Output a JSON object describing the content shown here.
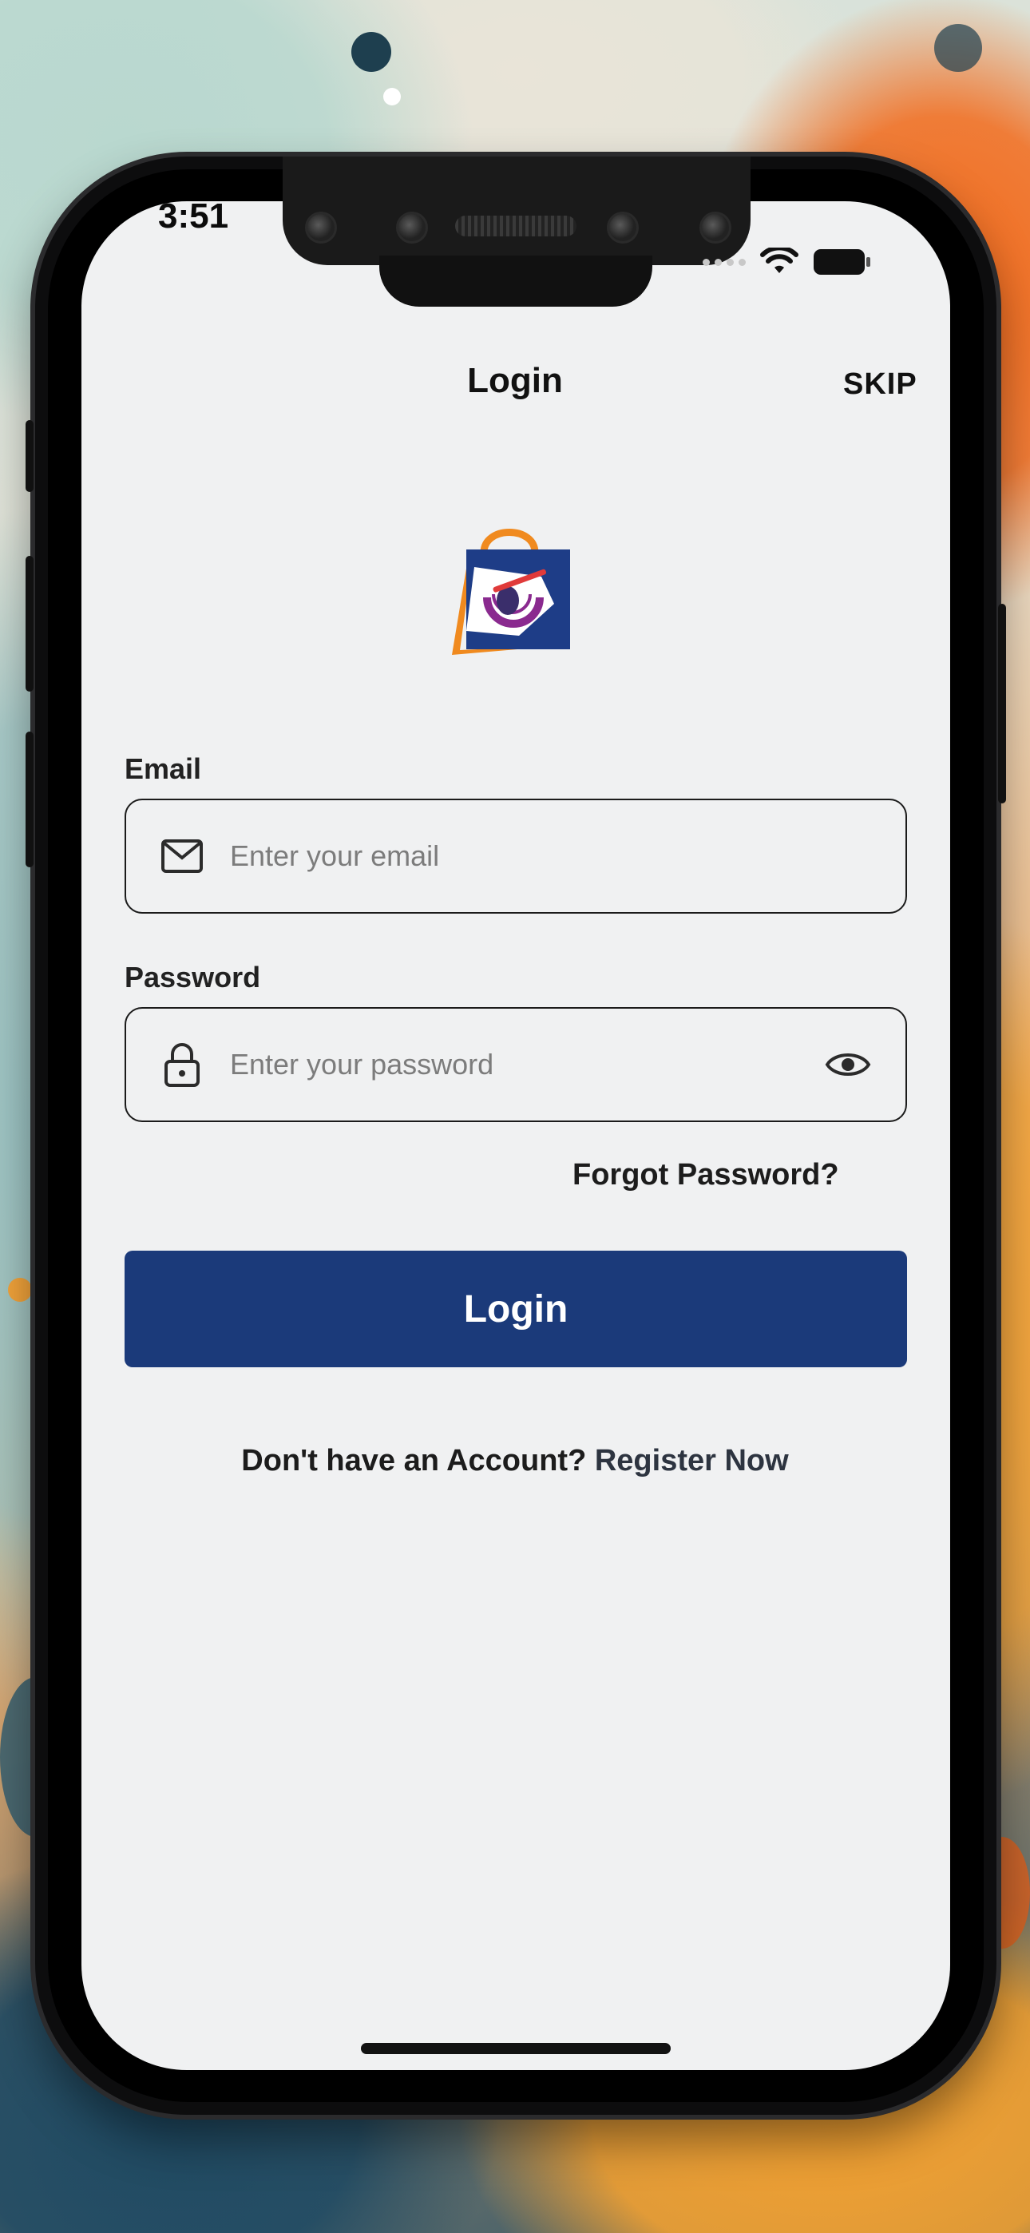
{
  "status_bar": {
    "time": "3:51"
  },
  "header": {
    "title": "Login",
    "skip_label": "SKIP"
  },
  "logo": {
    "name": "shopping-bag-logo"
  },
  "email": {
    "label": "Email",
    "placeholder": "Enter your email",
    "value": "",
    "icon": "mail-icon"
  },
  "password": {
    "label": "Password",
    "placeholder": "Enter your password",
    "value": "",
    "icon": "lock-icon",
    "toggle_icon": "eye-icon"
  },
  "forgot_label": "Forgot Password?",
  "login_button": "Login",
  "register": {
    "question": "Don't have an Account?",
    "link": "Register Now"
  },
  "colors": {
    "primary": "#1b3a7a",
    "screen_bg": "#f0f1f2",
    "logo_orange": "#f08a1f",
    "logo_navy": "#1e3d87",
    "logo_purple": "#8a2a8f"
  }
}
